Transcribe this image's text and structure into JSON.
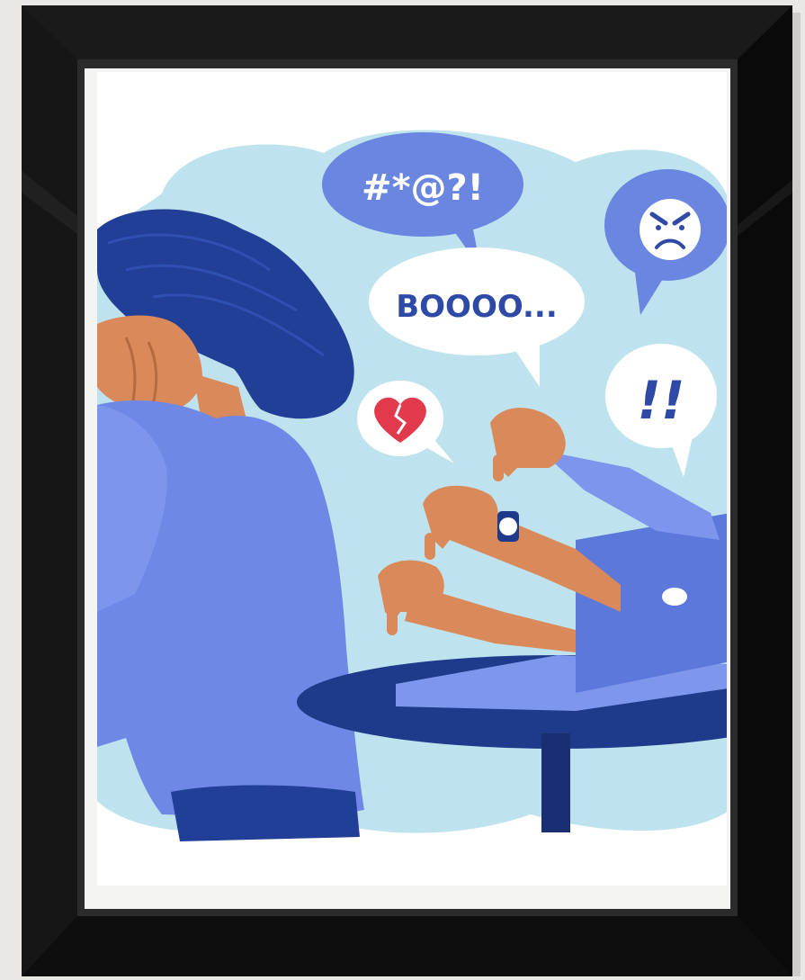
{
  "scene": {
    "bubbles": {
      "symbols": "#*@?!",
      "booo": "BOOOO...",
      "exclaim": "!!"
    },
    "icons": [
      "angry-face-icon",
      "broken-heart-icon",
      "watch-icon"
    ],
    "colors": {
      "wall": "#e9e8e4",
      "frame": "#111111",
      "mat": "#ffffff",
      "cloud": "#bfe3ee",
      "blue_bubble": "#6a86e0",
      "white_bubble": "#ffffff",
      "text_blue": "#2e4aa6",
      "hair": "#223f97",
      "shirt": "#6f88e6",
      "skin": "#d9895a",
      "table": "#1f3a8a",
      "laptop": "#5c78da",
      "heart": "#e23a4d"
    }
  }
}
